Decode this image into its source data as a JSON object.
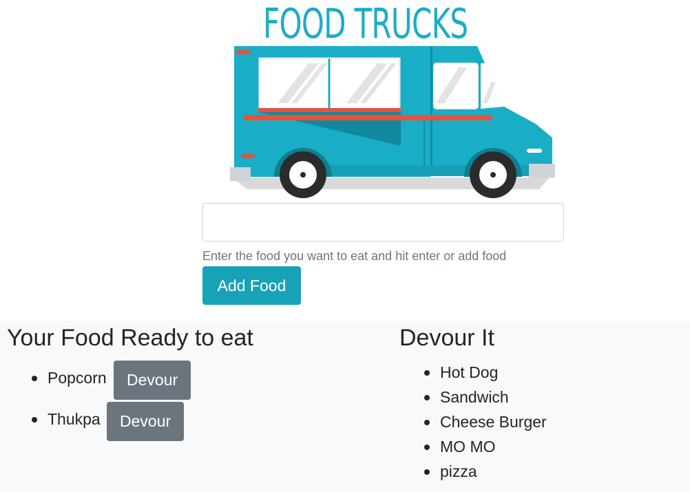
{
  "logo": {
    "text": "FOOD TRUCKS"
  },
  "form": {
    "input_value": "",
    "input_placeholder": "",
    "help_text": "Enter the food you want to eat and hit enter or add food",
    "add_button_label": "Add Food"
  },
  "ready": {
    "title": "Your Food Ready to eat",
    "items": [
      {
        "name": "Popcorn",
        "button_label": "Devour"
      },
      {
        "name": "Thukpa",
        "button_label": "Devour"
      }
    ]
  },
  "devoured": {
    "title": "Devour It",
    "items": [
      "Hot Dog",
      "Sandwich",
      "Cheese Burger",
      "MO MO",
      "pizza"
    ]
  },
  "colors": {
    "accent": "#17a2b8",
    "secondary_button": "#6c757d",
    "truck_body": "#1aadc6",
    "truck_stripe": "#e8513a",
    "list_background": "#f8f9fa"
  }
}
